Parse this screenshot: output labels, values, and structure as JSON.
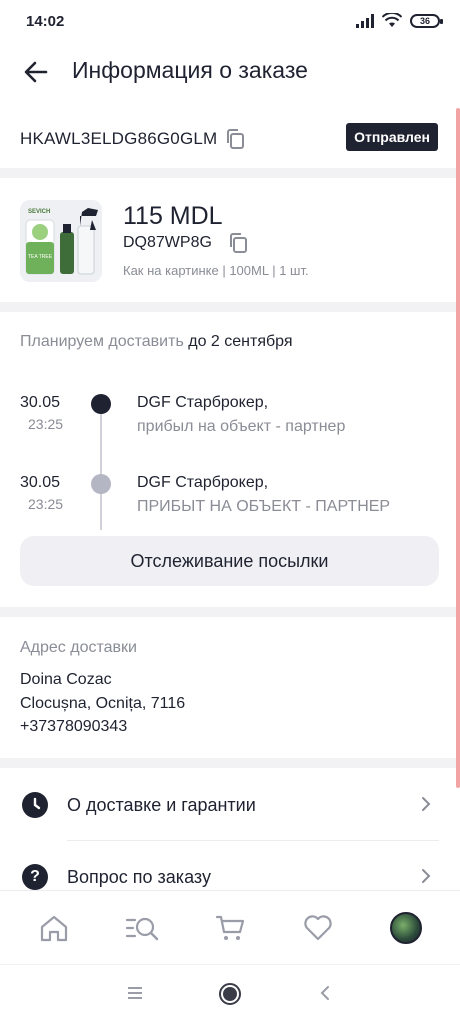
{
  "status_bar": {
    "time": "14:02",
    "battery": "36"
  },
  "header": {
    "title": "Информация о заказе"
  },
  "order": {
    "id": "HKAWL3ELDG86G0GLM",
    "status": "Отправлен"
  },
  "product": {
    "price": "115 MDL",
    "sku": "DQ87WP8G",
    "variant": "Как на картинке | 100ML | 1 шт.",
    "brand_mark": "SEVICH",
    "label_text": "TEA TREE"
  },
  "delivery_plan": {
    "prefix": "Планируем доставить",
    "date": "до 2 сентября"
  },
  "timeline": [
    {
      "date": "30.05",
      "time": "23:25",
      "title": "DGF Старброкер,",
      "subtitle": "прибыл на объект - партнер",
      "active": true
    },
    {
      "date": "30.05",
      "time": "23:25",
      "title": "DGF Старброкер,",
      "subtitle": "ПРИБЫТ НА ОБЪЕКТ - ПАРТНЕР",
      "active": false
    }
  ],
  "tracking_button": "Отслеживание посылки",
  "address": {
    "label": "Адрес доставки",
    "name": "Doina Cozac",
    "city": "Clocușna, Ocnița, 7116",
    "phone": "+37378090343"
  },
  "menu": [
    {
      "label": "О доставке и гарантии",
      "icon": "clock-icon"
    },
    {
      "label": "Вопрос по заказу",
      "icon": "question-icon",
      "icon_glyph": "?"
    }
  ],
  "bottom_nav": [
    "home-icon",
    "catalog-search-icon",
    "cart-icon",
    "favorites-icon",
    "profile-avatar"
  ],
  "colors": {
    "primary": "#1f2230",
    "muted": "#8a8c96",
    "badge_bg": "#1f2230",
    "divider": "#f2f2f5",
    "scroll": "#f3a3a3"
  }
}
